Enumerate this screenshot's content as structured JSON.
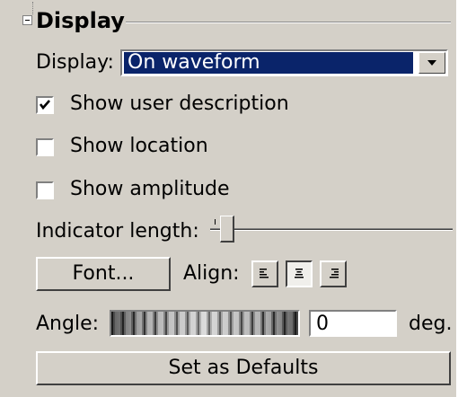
{
  "section": {
    "title": "Display"
  },
  "display": {
    "label": "Display:",
    "selected": "On waveform"
  },
  "checkboxes": [
    {
      "label": "Show user description",
      "checked": true
    },
    {
      "label": "Show location",
      "checked": false
    },
    {
      "label": "Show amplitude",
      "checked": false
    }
  ],
  "indicator": {
    "label": "Indicator length:",
    "level": 0.05
  },
  "font_button": {
    "label": "Font..."
  },
  "align": {
    "label": "Align:",
    "options": [
      "left",
      "center",
      "right"
    ],
    "selected": "center"
  },
  "angle": {
    "label": "Angle:",
    "value": "0",
    "unit": "deg."
  },
  "defaults_button": {
    "label": "Set as Defaults"
  },
  "colors": {
    "panel": "#d4d0c8",
    "selection": "#0a246a"
  },
  "icons": {
    "collapse": "collapse-minus-icon",
    "dropdown": "chevron-down-icon",
    "check": "checkmark-icon",
    "align_left": "align-left-icon",
    "align_center": "align-center-icon",
    "align_right": "align-right-icon"
  }
}
